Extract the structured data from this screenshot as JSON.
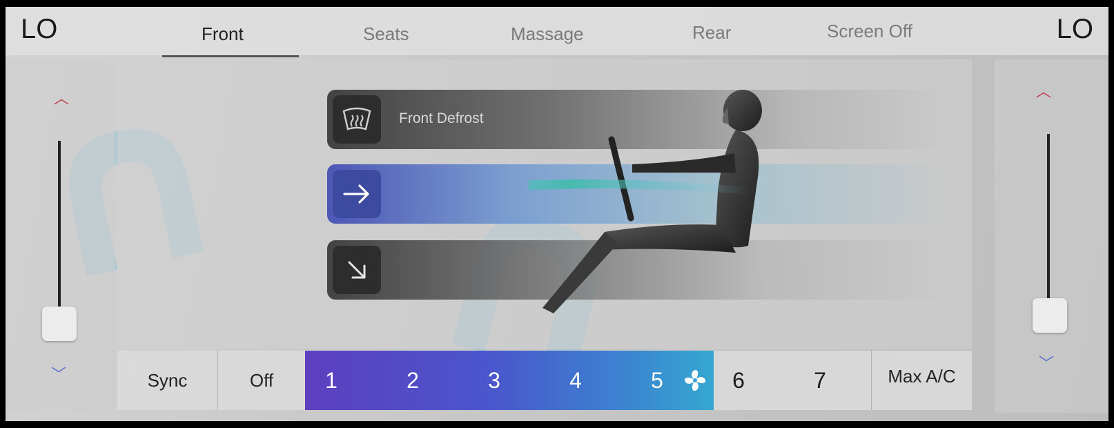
{
  "climate": {
    "left_temp": "LO",
    "right_temp": "LO"
  },
  "tabs": [
    {
      "label": "Front",
      "active": true
    },
    {
      "label": "Seats",
      "active": false
    },
    {
      "label": "Massage",
      "active": false
    },
    {
      "label": "Rear",
      "active": false
    },
    {
      "label": "Screen Off",
      "active": false
    }
  ],
  "left_temp_slider": {
    "level": 0.05,
    "up_icon": "chevron-up-icon",
    "down_icon": "chevron-down-icon"
  },
  "right_temp_slider": {
    "level": 0.05,
    "up_icon": "chevron-up-icon",
    "down_icon": "chevron-down-icon"
  },
  "airflow_modes": [
    {
      "icon": "windshield-defrost-icon",
      "label": "Front Defrost",
      "active": false
    },
    {
      "icon": "arrow-right-icon",
      "label": "",
      "active": true
    },
    {
      "icon": "arrow-down-right-icon",
      "label": "",
      "active": false
    }
  ],
  "fan": {
    "sync_label": "Sync",
    "off_label": "Off",
    "levels": [
      "1",
      "2",
      "3",
      "4",
      "5",
      "6",
      "7"
    ],
    "current_level": 5,
    "max_ac_label": "Max A/C",
    "fan_icon": "fan-icon"
  },
  "colors": {
    "fan_gradient_start": "#5d3fc0",
    "fan_gradient_end": "#35a7d0",
    "chevron_up": "#c2404d",
    "chevron_down": "#5b6fc9"
  }
}
